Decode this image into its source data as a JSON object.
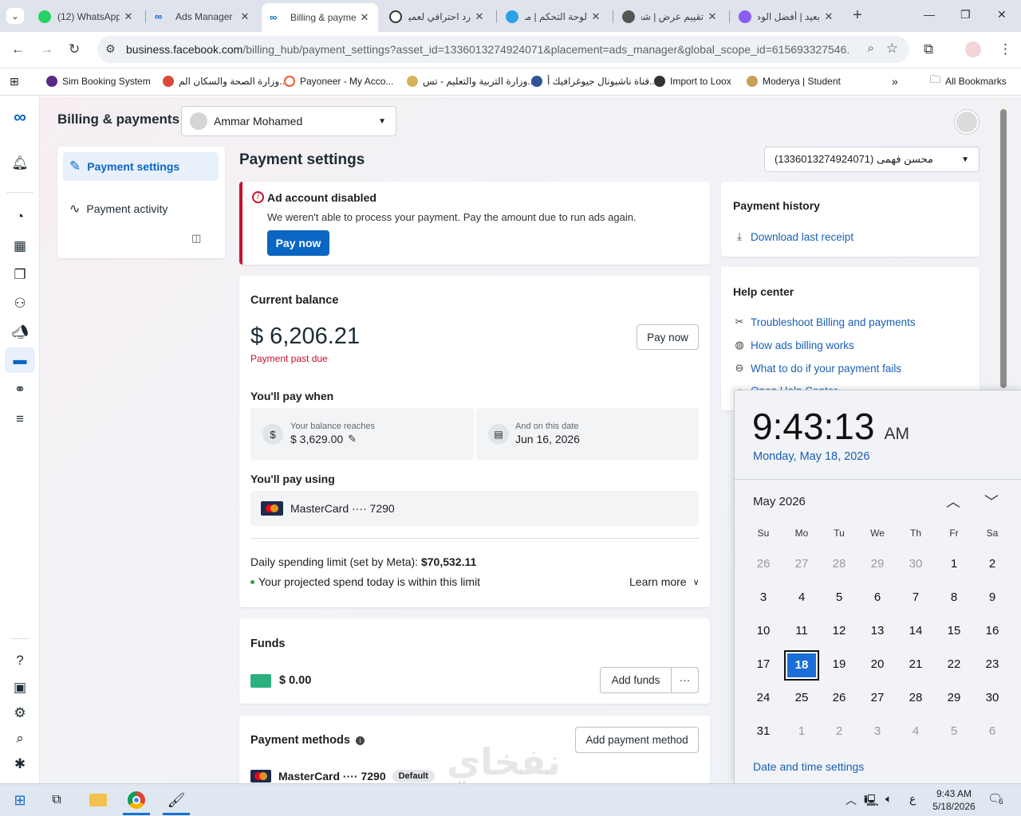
{
  "browser": {
    "tabs": [
      {
        "title": "(12) WhatsApp",
        "active": false
      },
      {
        "title": "Ads Manager",
        "active": false
      },
      {
        "title": "Billing & payments",
        "active": true
      },
      {
        "title": "رد احترافي لعميل",
        "active": false
      },
      {
        "title": "لوحة التحكم | مستقل",
        "active": false
      },
      {
        "title": "تقييم عرض | شغل",
        "active": false
      },
      {
        "title": "بعيد | أفضل الوظا",
        "active": false
      }
    ],
    "url_host": "business.facebook.com",
    "url_path": "/billing_hub/payment_settings?asset_id=1336013274924071&placement=ads_manager&global_scope_id=615693327546...",
    "bookmarks": [
      "Sim Booking System",
      "وزارة الصحة والسكان الم...",
      "Payoneer - My Acco...",
      "وزارة التربية والتعليم - تس...",
      "قناة ناشيونال جيوغرافيك أ...",
      "Import to Loox",
      "Moderya | Student"
    ],
    "all_bookmarks": "All Bookmarks"
  },
  "header": {
    "title": "Billing & payments",
    "account_selector": "Ammar Mohamed",
    "ad_account_selector": "محسن فهمى (1336013274924071)"
  },
  "sidebar": {
    "items": [
      {
        "label": "Payment settings",
        "active": true
      },
      {
        "label": "Payment activity",
        "active": false
      }
    ]
  },
  "main": {
    "page_title": "Payment settings",
    "alert": {
      "title": "Ad account disabled",
      "message": "We weren't able to process your payment. Pay the amount due to run ads again.",
      "button": "Pay now"
    },
    "balance": {
      "heading": "Current balance",
      "amount": "$ 6,206.21",
      "status": "Payment past due",
      "button": "Pay now",
      "pay_when_heading": "You'll pay when",
      "threshold_label": "Your balance reaches",
      "threshold_value": "$ 3,629.00",
      "date_label": "And on this date",
      "date_value": "Jun 16, 2026",
      "pay_using_heading": "You'll pay using",
      "card": "MasterCard ···· 7290",
      "limit_label": "Daily spending limit (set by Meta): ",
      "limit_value": "$70,532.11",
      "projected": "Your projected spend today is within this limit",
      "learn_more": "Learn more"
    },
    "funds": {
      "heading": "Funds",
      "amount": "$ 0.00",
      "button": "Add funds",
      "more": "···"
    },
    "methods": {
      "heading": "Payment methods",
      "button": "Add payment method",
      "card": "MasterCard ···· 7290",
      "badge": "Default"
    }
  },
  "right": {
    "history": {
      "heading": "Payment history",
      "link": "Download last receipt"
    },
    "help": {
      "heading": "Help center",
      "links": [
        "Troubleshoot Billing and payments",
        "How ads billing works",
        "What to do if your payment fails",
        "Open Help Center"
      ]
    }
  },
  "clock": {
    "time": "9:43:13",
    "ampm": "AM",
    "date": "Monday, May 18, 2026",
    "month": "May 2026",
    "weekdays": [
      "Su",
      "Mo",
      "Tu",
      "We",
      "Th",
      "Fr",
      "Sa"
    ],
    "weeks": [
      [
        "26",
        "27",
        "28",
        "29",
        "30",
        "1",
        "2"
      ],
      [
        "3",
        "4",
        "5",
        "6",
        "7",
        "8",
        "9"
      ],
      [
        "10",
        "11",
        "12",
        "13",
        "14",
        "15",
        "16"
      ],
      [
        "17",
        "18",
        "19",
        "20",
        "21",
        "22",
        "23"
      ],
      [
        "24",
        "25",
        "26",
        "27",
        "28",
        "29",
        "30"
      ],
      [
        "31",
        "1",
        "2",
        "3",
        "4",
        "5",
        "6"
      ]
    ],
    "today": "18",
    "settings_link": "Date and time settings"
  },
  "taskbar": {
    "time": "9:43 AM",
    "date": "5/18/2026",
    "lang": "ع",
    "notifications": "6"
  },
  "watermark": "نفخاي",
  "colors": {
    "accent": "#0a66c2",
    "alert": "#c8102e",
    "link": "#1a5fb4"
  }
}
